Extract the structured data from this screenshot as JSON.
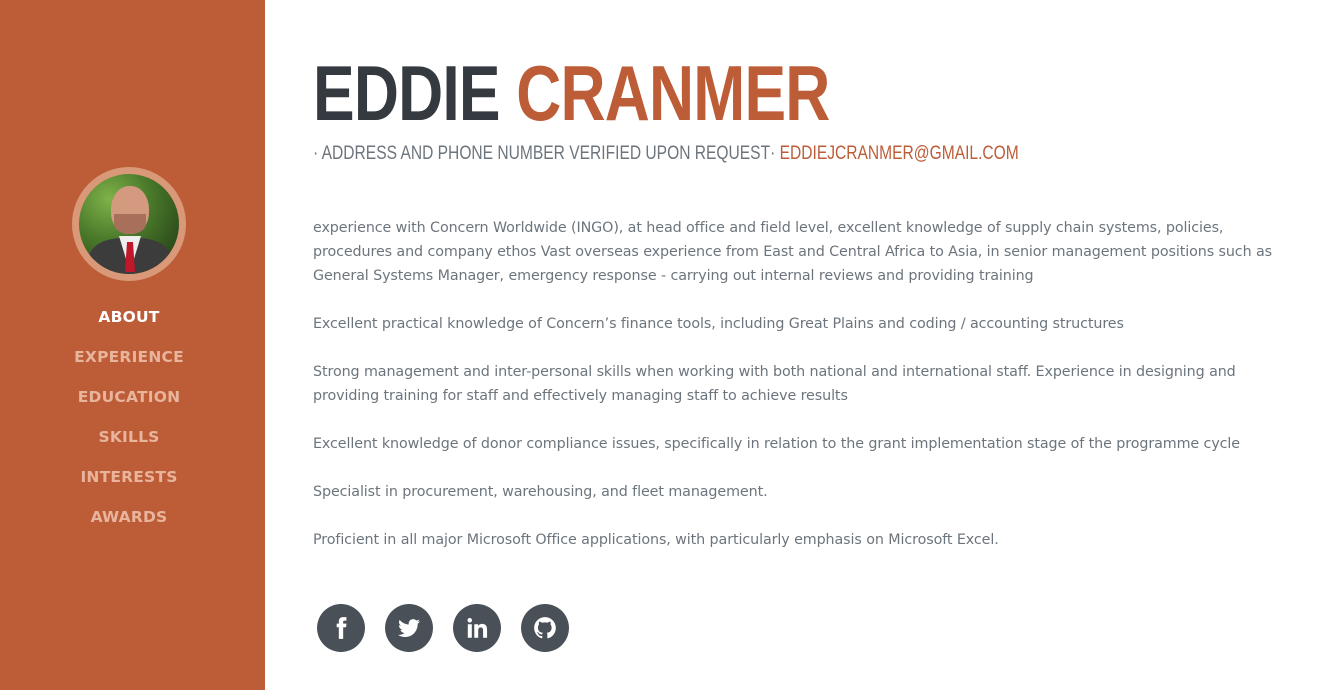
{
  "profile": {
    "first_name": "EDDIE",
    "last_name": "CRANMER",
    "subheading_text": "· ADDRESS AND PHONE NUMBER VERIFIED UPON REQUEST· ",
    "email": "EDDIEJCRANMER@GMAIL.COM",
    "avatar_icon": "profile-photo"
  },
  "nav": {
    "items": [
      {
        "label": "ABOUT",
        "active": true
      },
      {
        "label": "EXPERIENCE",
        "active": false
      },
      {
        "label": "EDUCATION",
        "active": false
      },
      {
        "label": "SKILLS",
        "active": false
      },
      {
        "label": "INTERESTS",
        "active": false
      },
      {
        "label": "AWARDS",
        "active": false
      }
    ]
  },
  "about": {
    "paragraphs": [
      "experience with Concern Worldwide (INGO), at head office and field level, excellent knowledge of supply chain systems, policies, procedures and company ethos Vast overseas experience from East and Central Africa to Asia, in senior management positions such as General Systems Manager, emergency response - carrying out internal reviews and providing training",
      "Excellent practical knowledge of Concern’s finance tools, including Great Plains and coding / accounting structures",
      "Strong management and inter-personal skills when working with both national and international staff. Experience in designing and providing training for staff and effectively managing staff to achieve results",
      "Excellent knowledge of donor compliance issues, specifically in relation to the grant implementation stage of the programme cycle",
      "Specialist in procurement, warehousing, and fleet management.",
      "Proficient in all major Microsoft Office applications, with particularly emphasis on Microsoft Excel."
    ]
  },
  "social": {
    "icons": [
      "facebook-icon",
      "twitter-icon",
      "linkedin-icon",
      "github-icon"
    ]
  },
  "colors": {
    "primary": "#bd5d38",
    "sidebar_nav_inactive": "#e8b49c",
    "heading_dark": "#343a40",
    "text_gray": "#6c757d",
    "social_circle": "#495057"
  }
}
